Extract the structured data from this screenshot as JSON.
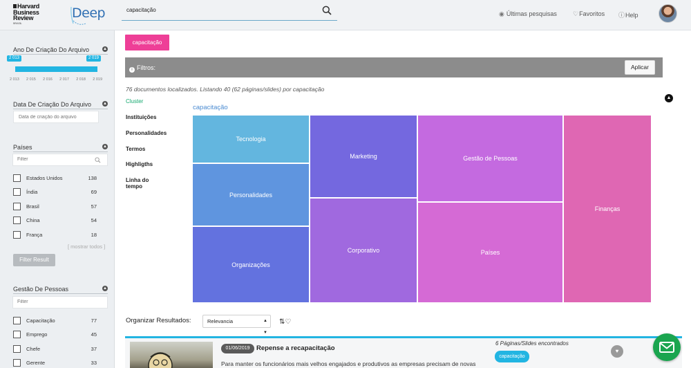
{
  "header": {
    "logo_hbr": [
      "Harvard",
      "Business",
      "Review"
    ],
    "logo_hbr_sub": "BRASIL",
    "logo_deep": "Deep",
    "search_value": "capacitação",
    "recent_searches": "Últimas pesquisas",
    "favorites": "Favoritos",
    "help": "Help"
  },
  "sidebar": {
    "year_section": {
      "title": "Ano De Criação Do Arquivo",
      "range_start": "2 013",
      "range_end": "2 019",
      "ticks": [
        "2 013",
        "2 015",
        "2 016",
        "2 017",
        "2 018",
        "2 019"
      ]
    },
    "date_section": {
      "title": "Data De Criação Do Arquivo",
      "placeholder": "Data de criação do arquivo"
    },
    "countries": {
      "title": "Países",
      "filter_placeholder": "Filter",
      "items": [
        {
          "label": "Estados Unidos",
          "count": "138"
        },
        {
          "label": "Índia",
          "count": "69"
        },
        {
          "label": "Brasil",
          "count": "57"
        },
        {
          "label": "China",
          "count": "54"
        },
        {
          "label": "França",
          "count": "18"
        }
      ],
      "show_all": "[ mostrar todos ]",
      "filter_button": "Filter Result"
    },
    "people_management": {
      "title": "Gestão De Pessoas",
      "filter_placeholder": "Filter",
      "items": [
        {
          "label": "Capacitação",
          "count": "77"
        },
        {
          "label": "Emprego",
          "count": "45"
        },
        {
          "label": "Chefe",
          "count": "37"
        },
        {
          "label": "Gerente",
          "count": "33"
        }
      ]
    }
  },
  "main": {
    "active_chip": "capacitação",
    "filters_label": "Filtros:",
    "apply_button": "Aplicar",
    "result_count": "76 documentos localizados. Listando 40 (62 páginas/slides) por capacitação",
    "tabs": [
      "Cluster",
      "Instituições",
      "Personalidades",
      "Termos",
      "Highligths",
      "Linha do tempo"
    ],
    "treemap": {
      "title": "capacitação",
      "cells": [
        {
          "label": "Tecnologia",
          "color": "#63b6df"
        },
        {
          "label": "Personalidades",
          "color": "#5f95df"
        },
        {
          "label": "Organizações",
          "color": "#6372df"
        },
        {
          "label": "Marketing",
          "color": "#7468df"
        },
        {
          "label": "Corporativo",
          "color": "#a069df"
        },
        {
          "label": "Gestão de Pessoas",
          "color": "#c46ae0"
        },
        {
          "label": "Países",
          "color": "#d56ad5"
        },
        {
          "label": "Finanças",
          "color": "#df67b3"
        }
      ]
    },
    "sort_label": "Organizar Resultados:",
    "sort_value": "Relevancia",
    "result": {
      "date": "01/06/2019",
      "title": "Repense a recapacitação",
      "snippet": "Para manter os funcionários mais velhos engajados e produtivos as empresas precisam de novas",
      "pages_found": "6 Páginas/Slides encontrados",
      "tag": "capacitação"
    }
  },
  "colors": {
    "accent_pink": "#ee3f97",
    "accent_blue": "#22b5e2",
    "filter_bar": "#8c8c8c",
    "cluster_green": "#13a86e",
    "mail_green": "#1aa54f"
  }
}
